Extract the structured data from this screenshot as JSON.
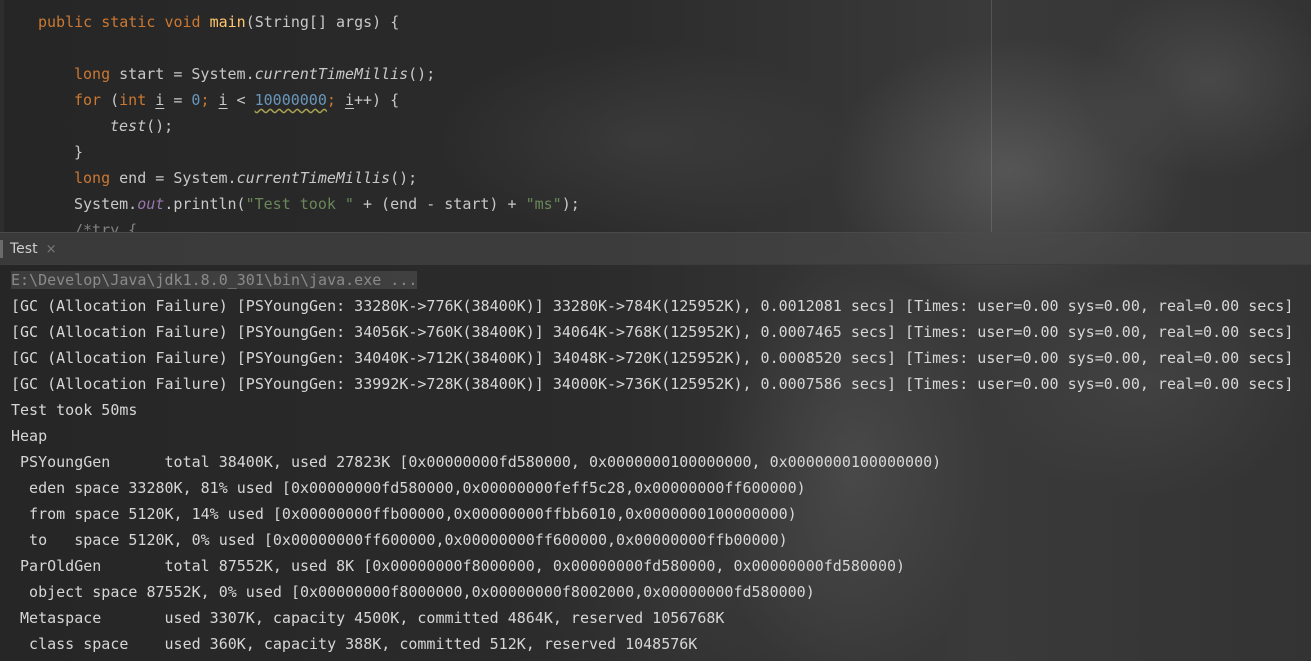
{
  "editor": {
    "line1": {
      "mod1": "public",
      "mod2": "static",
      "type": "void",
      "name": "main",
      "params": "(String[] args) {"
    },
    "line2": {
      "type": "long",
      "decl": " start = System.",
      "call": "currentTimeMillis",
      "tail": "();"
    },
    "line3": {
      "kw": "for",
      "open": " (",
      "type": "int",
      "sp": " ",
      "var1": "i",
      "assign": " = ",
      "zero": "0",
      "semi1": "; ",
      "var2": "i",
      "lt": " < ",
      "limit": "10000000",
      "semi2": "; ",
      "var3": "i",
      "tail": "++) {"
    },
    "line4": {
      "call": "test",
      "tail": "();"
    },
    "line5": {
      "text": "}"
    },
    "line6": {
      "type": "long",
      "decl": " end = System.",
      "call": "currentTimeMillis",
      "tail": "();"
    },
    "line7": {
      "pre": "System.",
      "field": "out",
      "mid": ".println(",
      "str1": "\"Test took \"",
      "mid2": " + (end - start) + ",
      "str2": "\"ms\"",
      "tail": ");"
    },
    "line8": {
      "text": "/*try {"
    }
  },
  "run_tab": {
    "label": "Test",
    "close": "×"
  },
  "console": {
    "command": "E:\\Develop\\Java\\jdk1.8.0_301\\bin\\java.exe ...",
    "lines": [
      "[GC (Allocation Failure) [PSYoungGen: 33280K->776K(38400K)] 33280K->784K(125952K), 0.0012081 secs] [Times: user=0.00 sys=0.00, real=0.00 secs]",
      "[GC (Allocation Failure) [PSYoungGen: 34056K->760K(38400K)] 34064K->768K(125952K), 0.0007465 secs] [Times: user=0.00 sys=0.00, real=0.00 secs]",
      "[GC (Allocation Failure) [PSYoungGen: 34040K->712K(38400K)] 34048K->720K(125952K), 0.0008520 secs] [Times: user=0.00 sys=0.00, real=0.00 secs]",
      "[GC (Allocation Failure) [PSYoungGen: 33992K->728K(38400K)] 34000K->736K(125952K), 0.0007586 secs] [Times: user=0.00 sys=0.00, real=0.00 secs]",
      "Test took 50ms",
      "Heap",
      " PSYoungGen      total 38400K, used 27823K [0x00000000fd580000, 0x0000000100000000, 0x0000000100000000)",
      "  eden space 33280K, 81% used [0x00000000fd580000,0x00000000feff5c28,0x00000000ff600000)",
      "  from space 5120K, 14% used [0x00000000ffb00000,0x00000000ffbb6010,0x0000000100000000)",
      "  to   space 5120K, 0% used [0x00000000ff600000,0x00000000ff600000,0x00000000ffb00000)",
      " ParOldGen       total 87552K, used 8K [0x00000000f8000000, 0x00000000fd580000, 0x00000000fd580000)",
      "  object space 87552K, 0% used [0x00000000f8000000,0x00000000f8002000,0x00000000fd580000)",
      " Metaspace       used 3307K, capacity 4500K, committed 4864K, reserved 1056768K",
      "  class space    used 360K, capacity 388K, committed 512K, reserved 1048576K"
    ]
  }
}
